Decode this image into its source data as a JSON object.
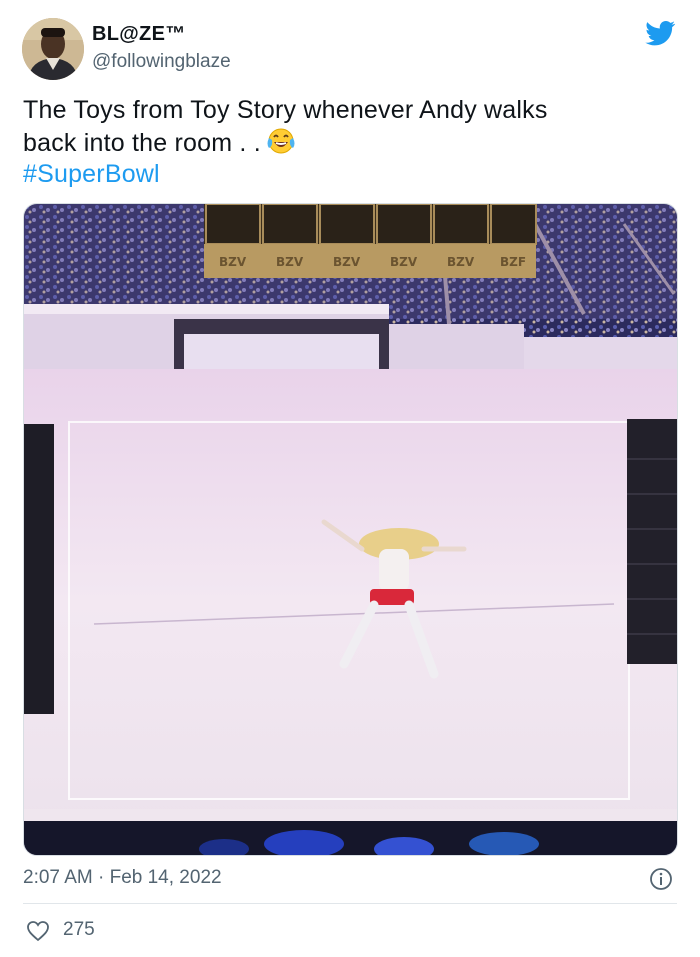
{
  "user": {
    "name": "BL@ZE™",
    "handle": "@followingblaze"
  },
  "tweet": {
    "line1": "The Toys from Toy Story whenever Andy walks",
    "line2": "back into the room . .",
    "emoji": "face-with-tears-of-joy",
    "hashtag": "#SuperBowl"
  },
  "media": {
    "description_icon": "photo",
    "box_labels": [
      "BZV",
      "BZV",
      "BZV",
      "BZV",
      "BZV",
      "BZF"
    ]
  },
  "meta": {
    "timestamp": "2:07 AM · Feb 14, 2022",
    "like_count": "275"
  },
  "colors": {
    "twitter_blue": "#1d9bf0",
    "secondary_text": "#536471"
  }
}
